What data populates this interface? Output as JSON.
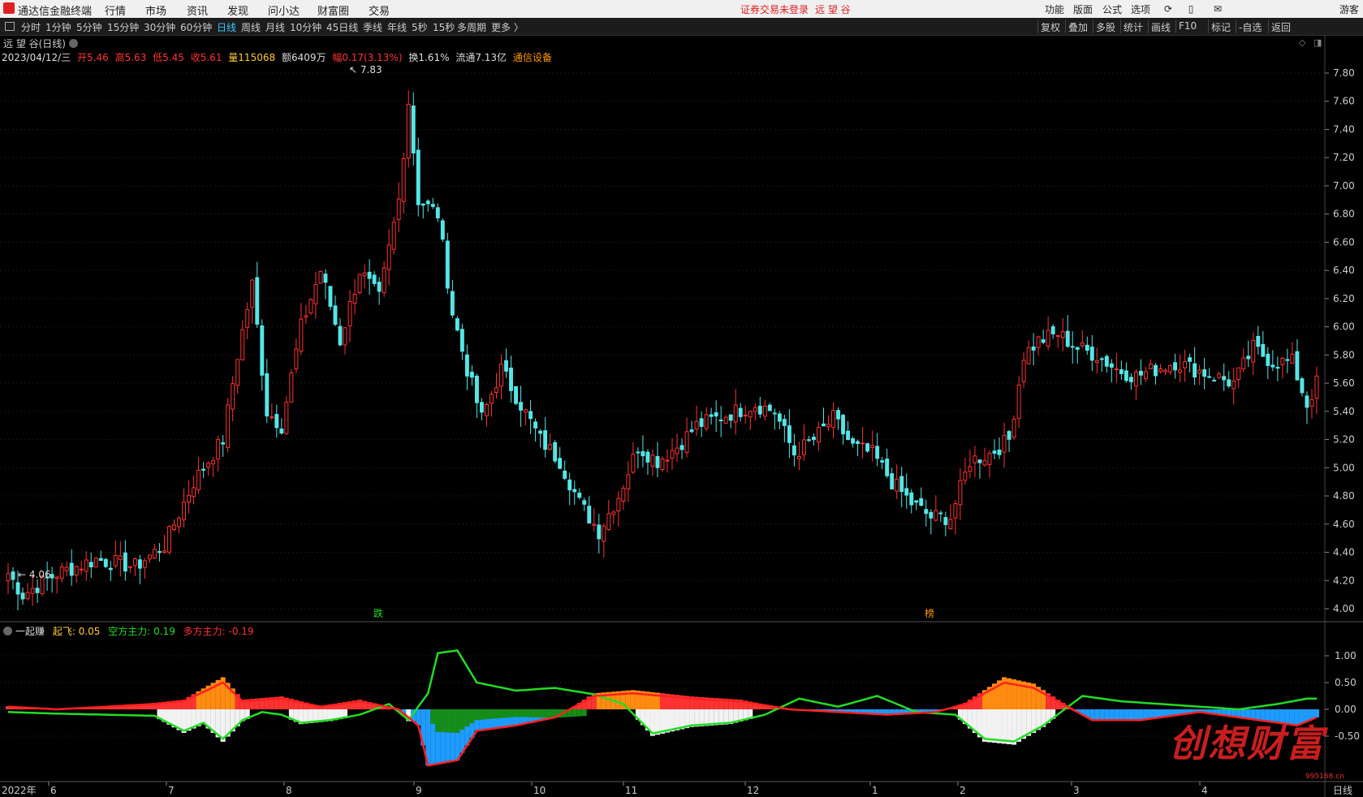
{
  "menubar": {
    "app_title": "通达信金融终端",
    "items": [
      "行情",
      "市场",
      "资讯",
      "发现",
      "问小达",
      "财富圈",
      "交易"
    ],
    "notice": "证券交易未登录",
    "stock_name": "远 望 谷",
    "right_items": [
      "功能",
      "版面",
      "公式",
      "选项"
    ],
    "right_user": "游客"
  },
  "toolbar": {
    "periods": [
      "分时",
      "1分钟",
      "5分钟",
      "15分钟",
      "30分钟",
      "60分钟",
      "日线",
      "周线",
      "月线",
      "10分钟",
      "45日线",
      "季线",
      "年线",
      "5秒",
      "15秒",
      "多周期",
      "更多 〉"
    ],
    "active_period": "日线",
    "right_items": [
      "复权",
      "叠加",
      "多股",
      "统计",
      "画线",
      "F10",
      "标记",
      "-自选",
      "返回"
    ]
  },
  "chart_title": "远 望 谷(日线)",
  "info_bar": {
    "date": "2023/04/12/三",
    "open": "开5.46",
    "high": "高5.63",
    "low": "低5.45",
    "close": "收5.61",
    "volume": "量115068",
    "amount": "额6409万",
    "change": "幅0.17(3.13%)",
    "turnover": "换1.61%",
    "float": "流通7.13亿",
    "sector": "通信设备"
  },
  "indicator": {
    "name": "一起赚",
    "qifei": "起飞: 0.05",
    "kong": "空方主力: 0.19",
    "duo": "多方主力: -0.19"
  },
  "markers": {
    "high_label": "7.83",
    "low_label": "4.06",
    "die_label": "跌",
    "bang_label": "榜"
  },
  "colors": {
    "up": "#ff3232",
    "down": "#55e6e6",
    "grid": "#2a2a2a",
    "green_line": "#22dd22",
    "red_line": "#ff2020",
    "orange_bar": "#ff8c10",
    "white_bar": "#ffffff",
    "blue_bar": "#1e9bff",
    "darkgreen_bar": "#158c15"
  },
  "watermark": {
    "text": "创想财富",
    "url": "995168.cn"
  },
  "x_axis": {
    "labels": [
      "2022年",
      "6",
      "7",
      "8",
      "9",
      "10",
      "11",
      "12",
      "1",
      "2",
      "3",
      "4"
    ],
    "period_tag": "日线"
  },
  "chart_data": {
    "type": "candlestick",
    "price_axis": {
      "ticks": [
        "7.80",
        "7.60",
        "7.40",
        "7.20",
        "7.00",
        "6.80",
        "6.60",
        "6.40",
        "6.20",
        "6.00",
        "5.80",
        "5.60",
        "5.40",
        "5.20",
        "5.00",
        "4.80",
        "4.60",
        "4.40",
        "4.20",
        "4.00"
      ],
      "min": 4.0,
      "max": 7.8
    },
    "indicator_axis": {
      "ticks": [
        "1.00",
        "0.50",
        "0.00",
        "-0.50"
      ],
      "min": -1.2,
      "max": 1.5
    },
    "anchors": [
      {
        "i": 0,
        "p": 4.25
      },
      {
        "i": 3,
        "p": 4.1
      },
      {
        "i": 10,
        "p": 4.25
      },
      {
        "i": 18,
        "p": 4.35
      },
      {
        "i": 26,
        "p": 4.3
      },
      {
        "i": 32,
        "p": 4.45
      },
      {
        "i": 38,
        "p": 4.9
      },
      {
        "i": 44,
        "p": 5.2
      },
      {
        "i": 47,
        "p": 5.8
      },
      {
        "i": 50,
        "p": 6.3
      },
      {
        "i": 53,
        "p": 5.4
      },
      {
        "i": 56,
        "p": 5.3
      },
      {
        "i": 60,
        "p": 6.0
      },
      {
        "i": 64,
        "p": 6.4
      },
      {
        "i": 68,
        "p": 5.9
      },
      {
        "i": 72,
        "p": 6.4
      },
      {
        "i": 76,
        "p": 6.2
      },
      {
        "i": 80,
        "p": 6.9
      },
      {
        "i": 82,
        "p": 7.6
      },
      {
        "i": 84,
        "p": 6.9
      },
      {
        "i": 88,
        "p": 6.8
      },
      {
        "i": 91,
        "p": 6.1
      },
      {
        "i": 94,
        "p": 5.7
      },
      {
        "i": 97,
        "p": 5.35
      },
      {
        "i": 101,
        "p": 5.7
      },
      {
        "i": 105,
        "p": 5.45
      },
      {
        "i": 109,
        "p": 5.2
      },
      {
        "i": 113,
        "p": 5.05
      },
      {
        "i": 117,
        "p": 4.75
      },
      {
        "i": 121,
        "p": 4.55
      },
      {
        "i": 125,
        "p": 4.8
      },
      {
        "i": 129,
        "p": 5.15
      },
      {
        "i": 133,
        "p": 5.05
      },
      {
        "i": 137,
        "p": 5.15
      },
      {
        "i": 141,
        "p": 5.3
      },
      {
        "i": 145,
        "p": 5.35
      },
      {
        "i": 149,
        "p": 5.4
      },
      {
        "i": 153,
        "p": 5.45
      },
      {
        "i": 157,
        "p": 5.4
      },
      {
        "i": 161,
        "p": 5.1
      },
      {
        "i": 165,
        "p": 5.2
      },
      {
        "i": 169,
        "p": 5.35
      },
      {
        "i": 173,
        "p": 5.15
      },
      {
        "i": 177,
        "p": 5.1
      },
      {
        "i": 181,
        "p": 4.9
      },
      {
        "i": 185,
        "p": 4.75
      },
      {
        "i": 189,
        "p": 4.65
      },
      {
        "i": 193,
        "p": 4.65
      },
      {
        "i": 197,
        "p": 5.05
      },
      {
        "i": 201,
        "p": 5.1
      },
      {
        "i": 205,
        "p": 5.2
      },
      {
        "i": 208,
        "p": 5.8
      },
      {
        "i": 211,
        "p": 5.9
      },
      {
        "i": 215,
        "p": 5.95
      },
      {
        "i": 219,
        "p": 5.85
      },
      {
        "i": 223,
        "p": 5.8
      },
      {
        "i": 227,
        "p": 5.7
      },
      {
        "i": 231,
        "p": 5.65
      },
      {
        "i": 235,
        "p": 5.7
      },
      {
        "i": 239,
        "p": 5.75
      },
      {
        "i": 243,
        "p": 5.7
      },
      {
        "i": 247,
        "p": 5.65
      },
      {
        "i": 251,
        "p": 5.6
      },
      {
        "i": 255,
        "p": 5.85
      },
      {
        "i": 259,
        "p": 5.75
      },
      {
        "i": 263,
        "p": 5.75
      },
      {
        "i": 266,
        "p": 5.45
      },
      {
        "i": 268,
        "p": 5.6
      }
    ],
    "count": 269,
    "high_point": {
      "value": 7.83
    },
    "low_point": {
      "value": 4.06
    },
    "green_line": [
      {
        "i": 0,
        "v": -0.05
      },
      {
        "i": 10,
        "v": -0.08
      },
      {
        "i": 20,
        "v": -0.1
      },
      {
        "i": 30,
        "v": -0.12
      },
      {
        "i": 36,
        "v": -0.4
      },
      {
        "i": 40,
        "v": -0.25
      },
      {
        "i": 44,
        "v": -0.55
      },
      {
        "i": 48,
        "v": -0.2
      },
      {
        "i": 52,
        "v": -0.05
      },
      {
        "i": 56,
        "v": -0.1
      },
      {
        "i": 60,
        "v": -0.25
      },
      {
        "i": 66,
        "v": -0.2
      },
      {
        "i": 72,
        "v": -0.1
      },
      {
        "i": 78,
        "v": 0.1
      },
      {
        "i": 82,
        "v": -0.2
      },
      {
        "i": 86,
        "v": 0.3
      },
      {
        "i": 88,
        "v": 1.05
      },
      {
        "i": 92,
        "v": 1.1
      },
      {
        "i": 96,
        "v": 0.5
      },
      {
        "i": 104,
        "v": 0.35
      },
      {
        "i": 112,
        "v": 0.4
      },
      {
        "i": 120,
        "v": 0.28
      },
      {
        "i": 126,
        "v": 0.1
      },
      {
        "i": 132,
        "v": -0.45
      },
      {
        "i": 140,
        "v": -0.3
      },
      {
        "i": 148,
        "v": -0.25
      },
      {
        "i": 155,
        "v": -0.1
      },
      {
        "i": 162,
        "v": 0.2
      },
      {
        "i": 170,
        "v": 0.05
      },
      {
        "i": 178,
        "v": 0.25
      },
      {
        "i": 186,
        "v": -0.05
      },
      {
        "i": 194,
        "v": -0.1
      },
      {
        "i": 200,
        "v": -0.55
      },
      {
        "i": 206,
        "v": -0.6
      },
      {
        "i": 212,
        "v": -0.3
      },
      {
        "i": 220,
        "v": 0.25
      },
      {
        "i": 228,
        "v": 0.15
      },
      {
        "i": 236,
        "v": 0.1
      },
      {
        "i": 244,
        "v": 0.05
      },
      {
        "i": 252,
        "v": 0.0
      },
      {
        "i": 260,
        "v": 0.1
      },
      {
        "i": 266,
        "v": 0.2
      }
    ],
    "red_line": [
      {
        "i": 0,
        "v": 0.05
      },
      {
        "i": 10,
        "v": 0.0
      },
      {
        "i": 20,
        "v": 0.05
      },
      {
        "i": 30,
        "v": 0.1
      },
      {
        "i": 36,
        "v": 0.15
      },
      {
        "i": 44,
        "v": 0.5
      },
      {
        "i": 48,
        "v": 0.15
      },
      {
        "i": 56,
        "v": 0.2
      },
      {
        "i": 64,
        "v": 0.05
      },
      {
        "i": 72,
        "v": 0.15
      },
      {
        "i": 80,
        "v": 0.0
      },
      {
        "i": 84,
        "v": -0.3
      },
      {
        "i": 86,
        "v": -1.05
      },
      {
        "i": 92,
        "v": -0.95
      },
      {
        "i": 96,
        "v": -0.4
      },
      {
        "i": 104,
        "v": -0.3
      },
      {
        "i": 112,
        "v": -0.15
      },
      {
        "i": 120,
        "v": 0.25
      },
      {
        "i": 128,
        "v": 0.3
      },
      {
        "i": 140,
        "v": 0.2
      },
      {
        "i": 150,
        "v": 0.15
      },
      {
        "i": 160,
        "v": 0.0
      },
      {
        "i": 170,
        "v": -0.05
      },
      {
        "i": 180,
        "v": -0.1
      },
      {
        "i": 190,
        "v": -0.05
      },
      {
        "i": 196,
        "v": 0.1
      },
      {
        "i": 204,
        "v": 0.5
      },
      {
        "i": 210,
        "v": 0.4
      },
      {
        "i": 216,
        "v": 0.1
      },
      {
        "i": 222,
        "v": -0.2
      },
      {
        "i": 232,
        "v": -0.2
      },
      {
        "i": 244,
        "v": -0.05
      },
      {
        "i": 256,
        "v": -0.2
      },
      {
        "i": 264,
        "v": -0.3
      },
      {
        "i": 268,
        "v": -0.15
      }
    ]
  }
}
